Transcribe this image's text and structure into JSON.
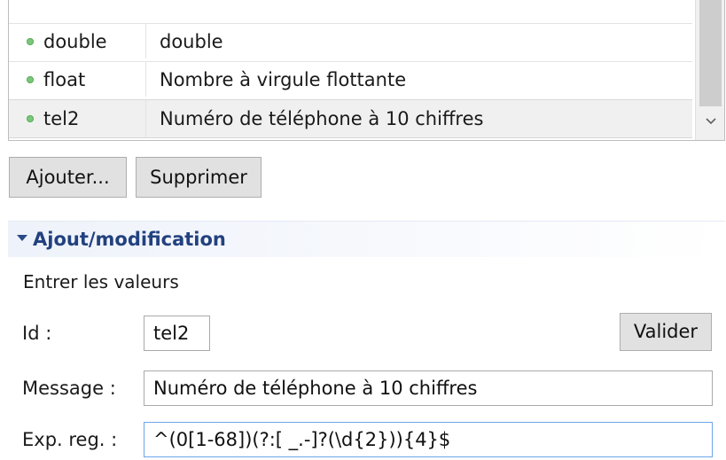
{
  "table": {
    "rows": [
      {
        "id": "double",
        "message": "double",
        "selected": false
      },
      {
        "id": "float",
        "message": "Nombre à virgule flottante",
        "selected": false
      },
      {
        "id": "tel2",
        "message": "Numéro de téléphone à 10 chiffres",
        "selected": true
      }
    ],
    "status_color": "#79c779",
    "scroll_down_icon": "chevron-down-icon"
  },
  "buttons": {
    "add_label": "Ajouter...",
    "delete_label": "Supprimer",
    "validate_label": "Valider"
  },
  "section": {
    "title": "Ajout/modification",
    "description": "Entrer les valeurs",
    "title_color": "#22417f"
  },
  "form": {
    "id_label": "Id :",
    "id_value": "tel2",
    "message_label": "Message :",
    "message_value": "Numéro de téléphone à 10 chiffres",
    "regex_label": "Exp. reg. :",
    "regex_value": "^(0[1-68])(?:[ _.-]?(\\d{2})){4}$"
  }
}
